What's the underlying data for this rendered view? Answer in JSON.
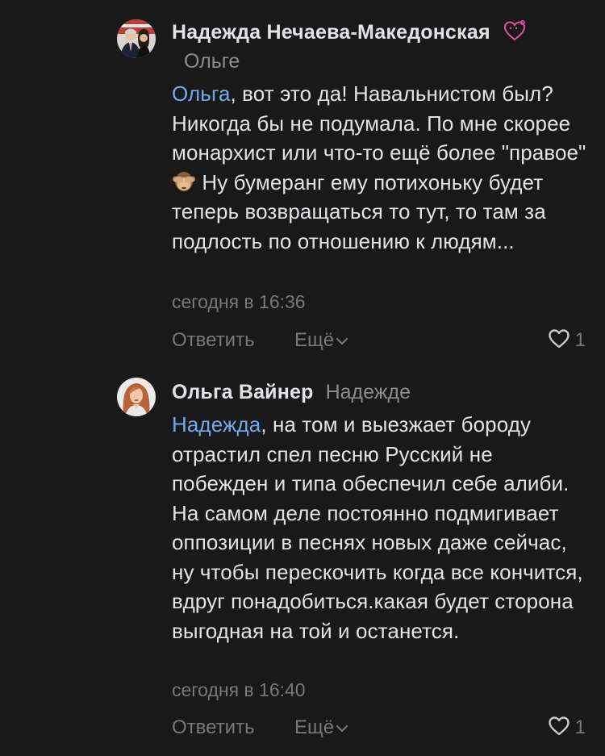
{
  "comments": [
    {
      "author": "Надежда Нечаева-Македонская",
      "reply_to": "Ольге",
      "mention": "Ольга",
      "text_part1": ", вот это да! Навальнистом был? Никогда бы не подумала. По мне скорее монархист или что-то ещё более \"правое\"",
      "emoji": "see-no-evil-monkey",
      "text_part2": " Ну бумеранг ему потихоньку будет теперь возвращаться то тут, то там за подлость по отношению к людям...",
      "timestamp": "сегодня в 16:36",
      "reply_label": "Ответить",
      "more_label": "Ещё",
      "likes": "1"
    },
    {
      "author": "Ольга Вайнер",
      "reply_to": "Надежде",
      "mention": "Надежда",
      "text_part1": ", на том и выезжает бороду отрастил спел песню Русский не побежден и типа обеспечил себе алиби. На самом деле постоянно подмигивает оппозиции в песнях новых даже сейчас, ну чтобы перескочить когда все кончится, вдруг понадобиться.какая будет сторона выгодная на той и останется.",
      "timestamp": "сегодня в 16:40",
      "reply_label": "Ответить",
      "more_label": "Ещё",
      "likes": "1"
    }
  ],
  "colors": {
    "background": "#19191a",
    "text": "#e1e3e6",
    "secondary": "#76787a",
    "mention": "#71aaeb",
    "badge": "#e64f9d"
  }
}
